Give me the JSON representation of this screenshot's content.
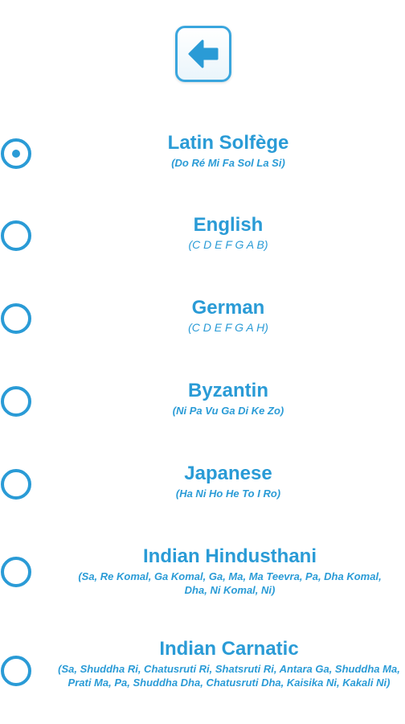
{
  "header": {
    "back_icon": "arrow-left-icon"
  },
  "options": [
    {
      "title": "Latin Solfège",
      "notes": "(Do Ré Mi Fa Sol La Si)",
      "selected": true
    },
    {
      "title": "English",
      "notes": "(C D E F G A B)",
      "selected": false
    },
    {
      "title": "German",
      "notes": "(C D E F G A H)",
      "selected": false
    },
    {
      "title": "Byzantin",
      "notes": "(Ni Pa Vu Ga Di Ke Zo)",
      "selected": false
    },
    {
      "title": "Japanese",
      "notes": "(Ha Ni Ho He To I Ro)",
      "selected": false
    },
    {
      "title": "Indian Hindusthani",
      "notes": "(Sa, Re Komal, Ga Komal, Ga, Ma, Ma Teevra, Pa, Dha Komal, Dha, Ni Komal, Ni)",
      "selected": false
    },
    {
      "title": "Indian Carnatic",
      "notes": "(Sa, Shuddha Ri, Chatusruti Ri, Shatsruti Ri, Antara Ga, Shuddha Ma, Prati Ma, Pa, Shuddha Dha, Chatusruti Dha, Kaisika Ni, Kakali Ni)",
      "selected": false
    }
  ],
  "colors": {
    "accent": "#2a9bd6",
    "background": "#ffffff"
  }
}
